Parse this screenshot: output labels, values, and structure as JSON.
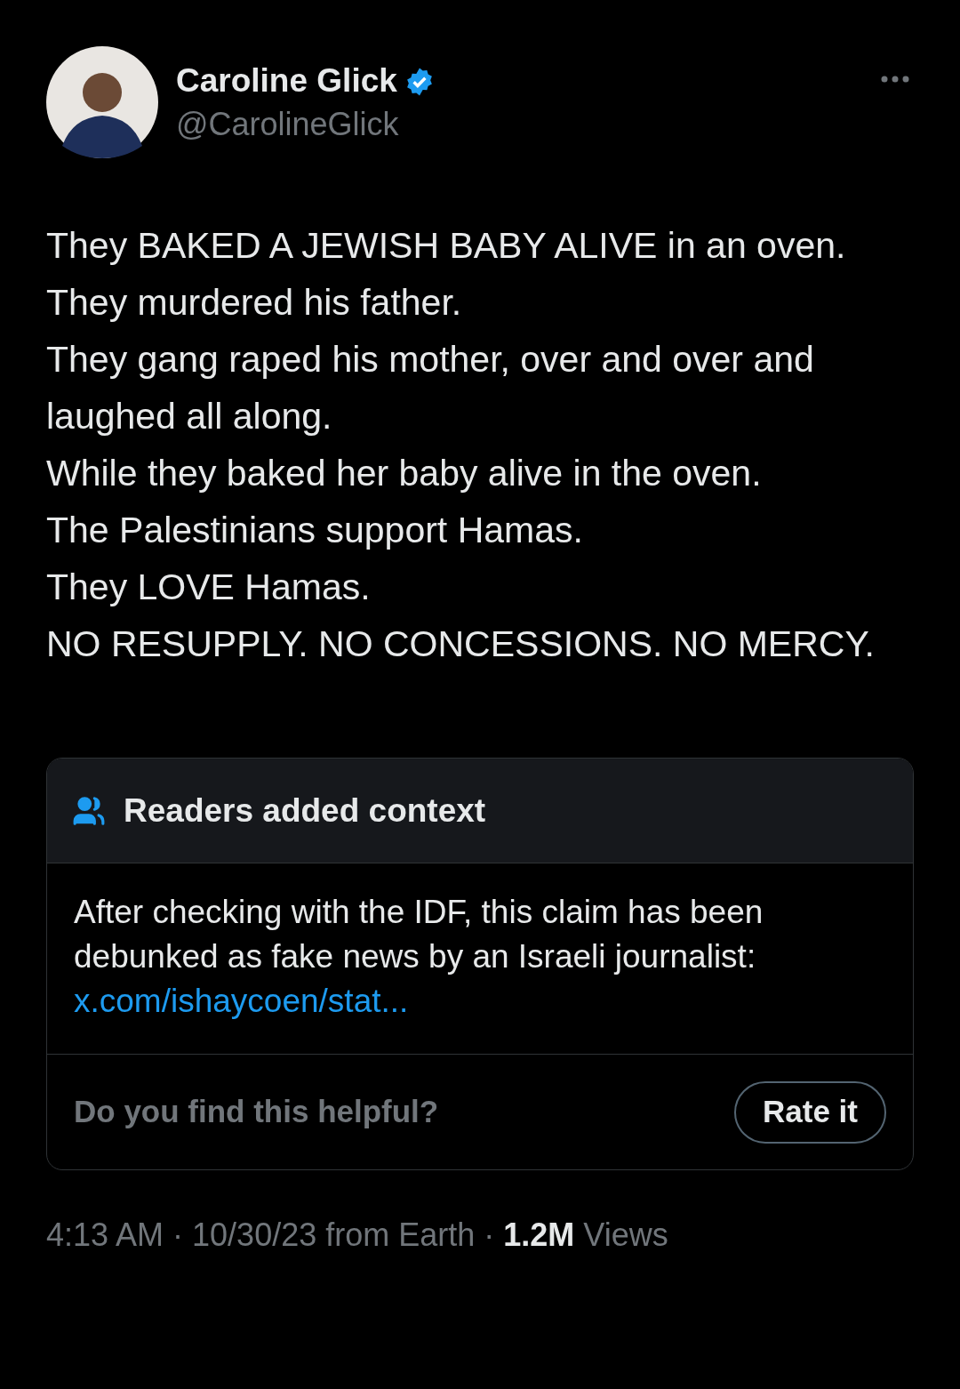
{
  "author": {
    "name": "Caroline Glick",
    "verified": true,
    "handle": "@CarolineGlick"
  },
  "body_lines": [
    "They BAKED A JEWISH BABY ALIVE in an oven.",
    "They murdered his father.",
    "They gang raped his mother, over and over and laughed all along.",
    "While they baked her baby alive in the oven.",
    "The Palestinians support Hamas.",
    "They LOVE Hamas.",
    "NO RESUPPLY. NO CONCESSIONS. NO MERCY."
  ],
  "note": {
    "title": "Readers added context",
    "text": "After checking with the IDF, this claim has been debunked as fake news by an Israeli journalist:",
    "link": "x.com/ishaycoen/stat...",
    "question": "Do you find this helpful?",
    "button": "Rate it"
  },
  "meta": "4:13 AM · 10/30/23 from Earth · **1.2M** Views"
}
